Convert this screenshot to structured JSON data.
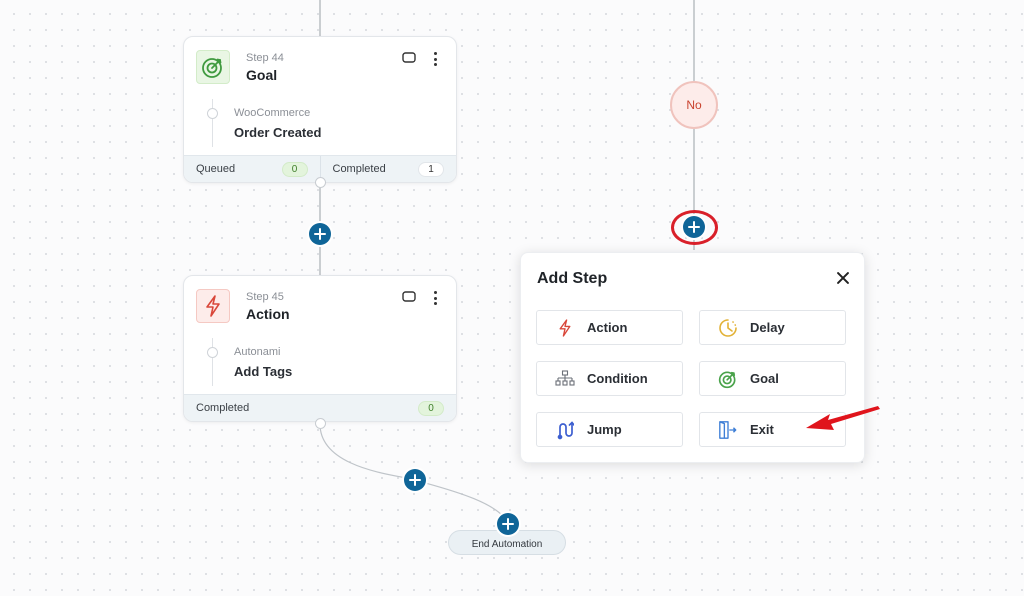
{
  "steps": [
    {
      "number": "Step 44",
      "title": "Goal",
      "type": "goal",
      "integration": "WooCommerce",
      "event": "Order Created",
      "stats": [
        {
          "label": "Queued",
          "value": "0",
          "style": "green"
        },
        {
          "label": "Completed",
          "value": "1",
          "style": "white"
        }
      ]
    },
    {
      "number": "Step 45",
      "title": "Action",
      "type": "action",
      "integration": "Autonami",
      "event": "Add Tags",
      "stats": [
        {
          "label": "Completed",
          "value": "0",
          "style": "green"
        }
      ]
    }
  ],
  "branch": {
    "label": "No",
    "color": "#c9432f"
  },
  "end_node": {
    "label": "End Automation"
  },
  "add_step_panel": {
    "title": "Add Step",
    "close_icon": "close-icon",
    "options": [
      {
        "label": "Action",
        "icon": "lightning-icon",
        "color": "#d9473a"
      },
      {
        "label": "Delay",
        "icon": "clock-icon",
        "color": "#e2b237"
      },
      {
        "label": "Condition",
        "icon": "hierarchy-icon",
        "color": "#6b7078"
      },
      {
        "label": "Goal",
        "icon": "target-icon",
        "color": "#4aa34b"
      },
      {
        "label": "Jump",
        "icon": "jump-icon",
        "color": "#3d5fd0"
      },
      {
        "label": "Exit",
        "icon": "exit-door-icon",
        "color": "#3f7fd6"
      }
    ]
  },
  "colors": {
    "add_button": "#0f6598",
    "highlight": "#d9202a",
    "annotation_arrow": "#e0141c"
  }
}
